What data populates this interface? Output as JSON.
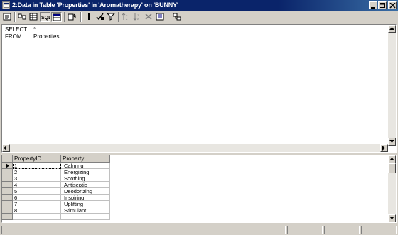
{
  "window": {
    "title": "2:Data in Table 'Properties' in 'Aromatherapy' on 'BUNNY'"
  },
  "toolbar": {
    "tools": [
      {
        "name": "properties-icon",
        "pressed": false
      },
      {
        "name": "diagram-pane-icon",
        "pressed": false
      },
      {
        "name": "grid-pane-icon",
        "pressed": false
      },
      {
        "name": "sql-pane-icon",
        "pressed": true,
        "label": "SQL"
      },
      {
        "name": "results-pane-icon",
        "pressed": true
      },
      {
        "name": "change-query-type-icon",
        "pressed": false
      },
      {
        "name": "run-icon",
        "pressed": false
      },
      {
        "name": "verify-sql-icon",
        "pressed": false
      },
      {
        "name": "remove-filter-icon",
        "pressed": false
      },
      {
        "name": "sort-ascending-icon",
        "pressed": false
      },
      {
        "name": "sort-descending-icon",
        "pressed": false
      },
      {
        "name": "remove-filter-x-icon",
        "pressed": false
      },
      {
        "name": "group-by-icon",
        "pressed": false
      },
      {
        "name": "add-table-icon",
        "pressed": false
      }
    ]
  },
  "sql": {
    "line1_keyword": "SELECT",
    "line1_value": "*",
    "line2_keyword": "FROM",
    "line2_value": "Properties"
  },
  "grid": {
    "columns": [
      "PropertyID",
      "Property"
    ],
    "rows": [
      {
        "id": "1",
        "property": "Calming"
      },
      {
        "id": "2",
        "property": "Energizing"
      },
      {
        "id": "3",
        "property": "Soothing"
      },
      {
        "id": "4",
        "property": "Antiseptic"
      },
      {
        "id": "5",
        "property": "Deodorizing"
      },
      {
        "id": "6",
        "property": "Inspiring"
      },
      {
        "id": "7",
        "property": "Uplifting"
      },
      {
        "id": "8",
        "property": "Stimulant"
      }
    ]
  }
}
